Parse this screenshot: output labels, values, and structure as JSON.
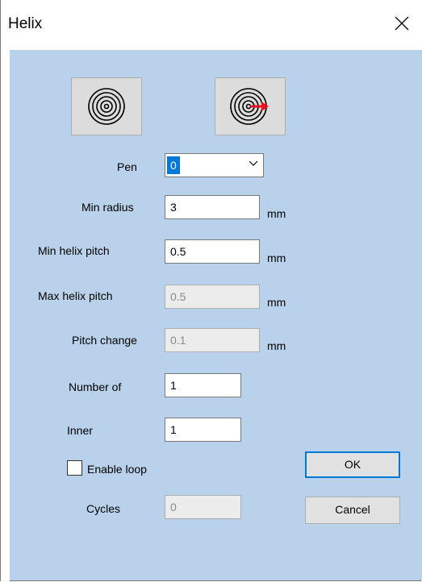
{
  "window": {
    "title": "Helix"
  },
  "fields": {
    "pen": {
      "label": "Pen",
      "value": "0"
    },
    "min_radius": {
      "label": "Min radius",
      "value": "3",
      "unit": "mm"
    },
    "min_helix_pitch": {
      "label": "Min helix pitch",
      "value": "0.5",
      "unit": "mm"
    },
    "max_helix_pitch": {
      "label": "Max helix pitch",
      "value": "0.5",
      "unit": "mm"
    },
    "pitch_change": {
      "label": "Pitch change",
      "value": "0.1",
      "unit": "mm"
    },
    "number_of": {
      "label": "Number of",
      "value": "1"
    },
    "inner": {
      "label": "Inner",
      "value": "1"
    },
    "enable_loop": {
      "label": "Enable loop",
      "checked": false
    },
    "cycles": {
      "label": "Cycles",
      "value": "0"
    }
  },
  "buttons": {
    "ok": "OK",
    "cancel": "Cancel"
  },
  "icons": {
    "spiral_in": "spiral-icon",
    "spiral_out": "spiral-outward-icon"
  },
  "colors": {
    "background": "#b9d1ea",
    "accent": "#0078d7",
    "arrow": "#e81123"
  }
}
